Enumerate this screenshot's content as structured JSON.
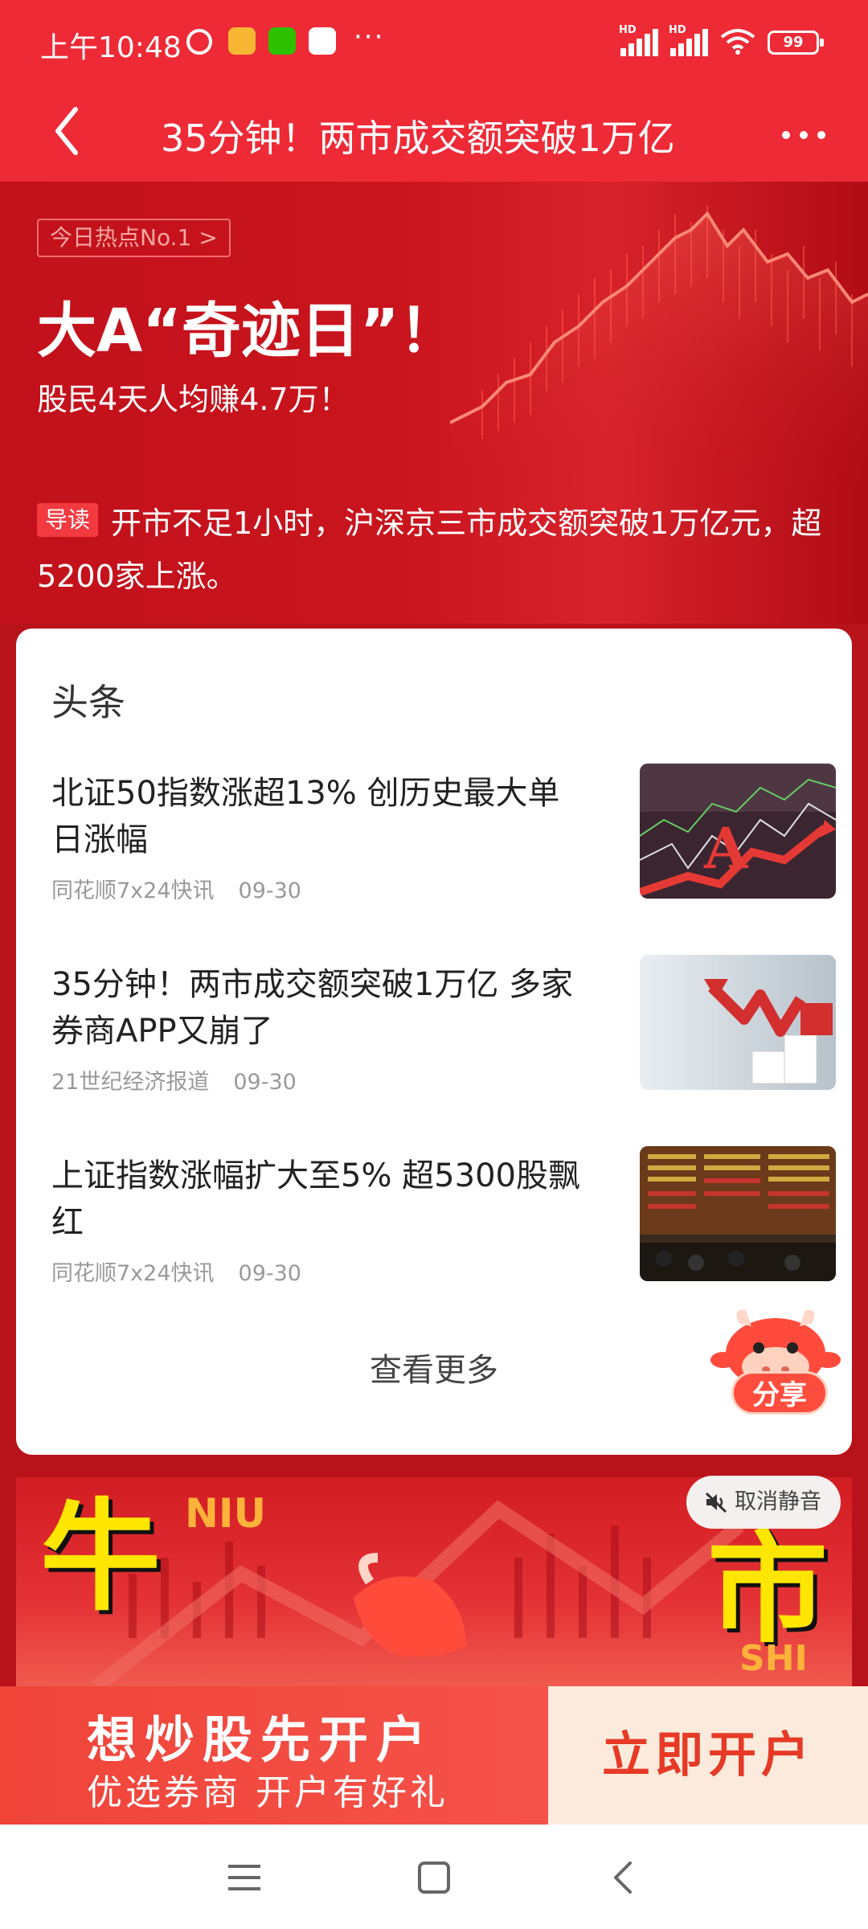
{
  "status_bar": {
    "time": "上午10:48",
    "dots": "···",
    "hd1": "HD",
    "hd2": "HD",
    "battery": "99"
  },
  "header": {
    "title": "35分钟！两市成交额突破1万亿"
  },
  "hero": {
    "badge": "今日热点No.1 >",
    "headline": "大A“奇迹日”！",
    "subtitle": "股民4天人均赚4.7万！",
    "intro_tag": "导读",
    "intro_text": "开市不足1小时，沪深京三市成交额突破1万亿元，超5200家上涨。"
  },
  "headlines": {
    "section_title": "头条",
    "items": [
      {
        "title": "北证50指数涨超13% 创历史最大单日涨幅",
        "source": "同花顺7x24快讯",
        "date": "09-30"
      },
      {
        "title": "35分钟！两市成交额突破1万亿 多家券商APP又崩了",
        "source": "21世纪经济报道",
        "date": "09-30"
      },
      {
        "title": "上证指数涨幅扩大至5% 超5300股飘红",
        "source": "同花顺7x24快讯",
        "date": "09-30"
      }
    ],
    "see_more": "查看更多"
  },
  "share": {
    "label": "分享"
  },
  "banner": {
    "niu": "牛",
    "niu_pinyin": "NIU",
    "shi": "市",
    "shi_pinyin": "SHI",
    "unmute": "取消静音"
  },
  "promo": {
    "main": "想炒股先开户",
    "sub": "优选券商 开户有好礼",
    "cta": "立即开户"
  },
  "colors": {
    "primary_red": "#ee2a36",
    "hero_red": "#c2111b",
    "cta_text": "#e63a26"
  }
}
